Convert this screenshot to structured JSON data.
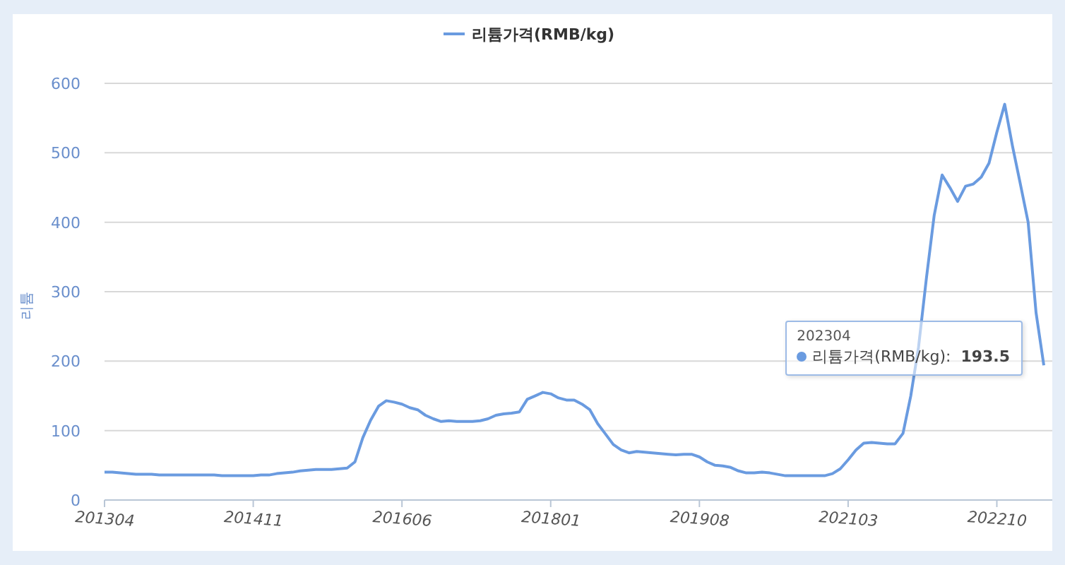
{
  "chart": {
    "chart_data": {
      "type": "line",
      "ylabel": "리튬",
      "categories": [
        "201304",
        null,
        null,
        null,
        null,
        null,
        null,
        null,
        null,
        null,
        null,
        null,
        null,
        null,
        null,
        null,
        null,
        null,
        null,
        "201411",
        null,
        null,
        null,
        null,
        null,
        null,
        null,
        null,
        null,
        null,
        null,
        null,
        null,
        null,
        null,
        null,
        null,
        null,
        "201606",
        null,
        null,
        null,
        null,
        null,
        null,
        null,
        null,
        null,
        null,
        null,
        null,
        null,
        null,
        null,
        null,
        null,
        null,
        "201801",
        null,
        null,
        null,
        null,
        null,
        null,
        null,
        null,
        null,
        null,
        null,
        null,
        null,
        null,
        null,
        null,
        null,
        null,
        "201908",
        null,
        null,
        null,
        null,
        null,
        null,
        null,
        null,
        null,
        null,
        null,
        null,
        null,
        null,
        null,
        null,
        null,
        null,
        "202103",
        null,
        null,
        null,
        null,
        null,
        null,
        null,
        null,
        null,
        null,
        null,
        null,
        null,
        null,
        null,
        null,
        null,
        null,
        "202210",
        null,
        null,
        null,
        null,
        null,
        null
      ],
      "series": [
        {
          "name": "리튬가격(RMB/kg)",
          "color": "#6a9be0",
          "values": [
            40,
            40,
            39,
            38,
            37,
            37,
            37,
            36,
            36,
            36,
            36,
            36,
            36,
            36,
            36,
            35,
            35,
            35,
            35,
            35,
            36,
            36,
            38,
            39,
            40,
            42,
            43,
            44,
            44,
            44,
            45,
            46,
            55,
            90,
            115,
            135,
            143,
            141,
            138,
            133,
            130,
            122,
            117,
            113,
            114,
            113,
            113,
            113,
            114,
            117,
            122,
            124,
            125,
            127,
            145,
            150,
            155,
            153,
            147,
            144,
            144,
            138,
            130,
            110,
            95,
            80,
            72,
            68,
            70,
            69,
            68,
            67,
            66,
            65,
            66,
            66,
            62,
            55,
            50,
            49,
            47,
            42,
            39,
            39,
            40,
            39,
            37,
            35,
            35,
            35,
            35,
            35,
            35,
            38,
            45,
            58,
            72,
            82,
            83,
            82,
            81,
            81,
            96,
            150,
            220,
            320,
            410,
            468,
            450,
            430,
            452,
            455,
            465,
            485,
            530,
            570,
            510,
            455,
            400,
            270,
            194
          ]
        }
      ],
      "grid": true,
      "ylim": [
        0,
        600
      ],
      "yticks": [
        0,
        100,
        200,
        300,
        400,
        500,
        600
      ]
    },
    "tooltip": {
      "category": "202304",
      "label": "리튬가격(RMB/kg):",
      "value": "193.5"
    }
  }
}
